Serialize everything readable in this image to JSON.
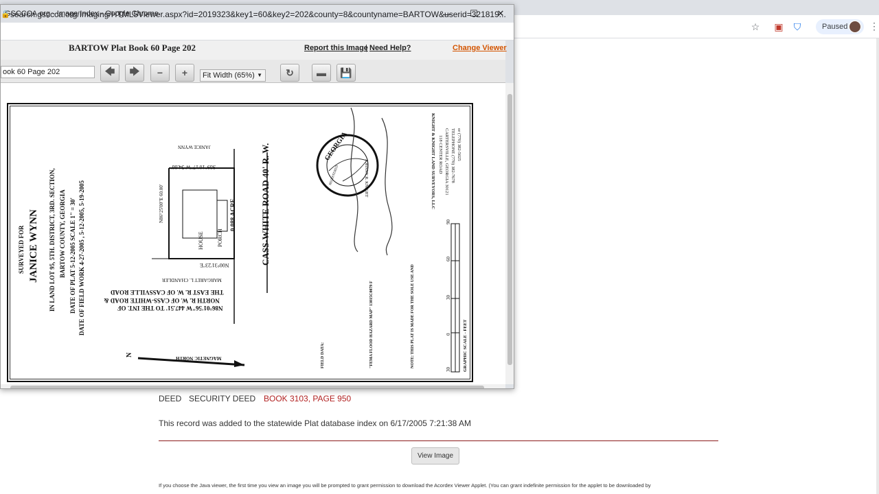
{
  "browser": {
    "profile_label": "Paused"
  },
  "popup": {
    "window_title": "GSCCCA.org - Image Index - Google Chrome",
    "url": "search.gsccca.org/Imaging/HTML5Viewer.aspx?id=2019323&key1=60&key2=202&county=8&countyname=BARTOW&userid=321819..."
  },
  "viewer": {
    "doc_title": "BARTOW Plat Book 60 Page 202",
    "report_link": "Report this Image",
    "link_separator": "|",
    "help_link": "Need Help?",
    "change_viewer": "Change Viewer",
    "doc_input_value": "ook 60 Page 202",
    "zoom_value": "Fit Width (65%)",
    "buttons": [
      "arrow-left-icon",
      "arrow-right-icon",
      "zoom-out-icon",
      "zoom-in-icon",
      "rotate-icon",
      "print-icon",
      "save-icon"
    ]
  },
  "plat": {
    "surveyed_for": "SURVEYED FOR",
    "client": "JANICE   WYNN",
    "land_lot": "IN LAND LOT 95, 5TH. DISTRICT, 3RD. SECTION,",
    "county": "BARTOW COUNTY, GEORGIA",
    "date_plat": "DATE OF PLAT  5-12-2005   SCALE  1\"  =  30'",
    "date_field": "DATE OF FIELD WORK 4-27-2005 , 5-12-2005, 5-19-2005",
    "road": "CASS-WHITE ROAD 40' R. W.",
    "acreage": "0.088 ACRE",
    "house": "HOUSE",
    "porch": "PORCH",
    "neighbor_top": "JANICE WYNN",
    "neighbor_bottom": "MARGARET L. CHANDLER",
    "bearing_1": "N86°25'00\"E   60.00'",
    "bearing_2": "S89°10'17\"W  54.88'",
    "bearing_3": "N00°31'23\"E",
    "bearing_4": "N86°01'56\"W   447.51'  TO THE INT. OF",
    "north_rw": "NORTH  R. W.  OF  CASS-WHITE  ROAD  &",
    "east_rw": "THE  EAST  R. W.  OF  CASSVILLE  ROAD",
    "magnetic_north": "MAGNETIC NORTH",
    "north_letter": "N",
    "seal_text": "GEORGIA",
    "seal_registered": "REGISTERED",
    "seal_name": "JOHNNY R. KNIGHT",
    "surveyor": "KNIGHT & KNIGHT LAND SURVEYORS, LLC",
    "surveyor_addr1": "118 CENTER ROAD",
    "surveyor_addr2": "CARTERSVILLE, GEORGIA  30121",
    "surveyor_phone": "TELEPHONE (770) 382-7678",
    "surveyor_fax": "or (770) 382-5025",
    "field_data": "FIELD DATA:",
    "flood_note": "\"FEMA FLOOD HAZARD MAP\" 13015C0079 F",
    "plat_note": "NOTE: THIS PLAT IS MADE FOR THE SOLE USE AND",
    "graphic_scale": "GRAPHIC SCALE - FEET",
    "scale_ticks": [
      "30",
      "0",
      "30",
      "60",
      "90"
    ]
  },
  "record": {
    "deed_label": "DEED",
    "deed_type": "SECURITY DEED",
    "deed_book": "BOOK 3103, PAGE 950",
    "added_text": "This record was added to the statewide Plat database index on 6/17/2005 7:21:38 AM",
    "view_image_label": "View Image",
    "java_note": "If you choose the Java viewer, the first time you view an image you will be prompted to grant permission to download the Acordex Viewer Applet. (You can grant indefinite permission for the applet to be downloaded by"
  },
  "colors": {
    "link_orange": "#d35400",
    "book_red": "#b22222"
  }
}
